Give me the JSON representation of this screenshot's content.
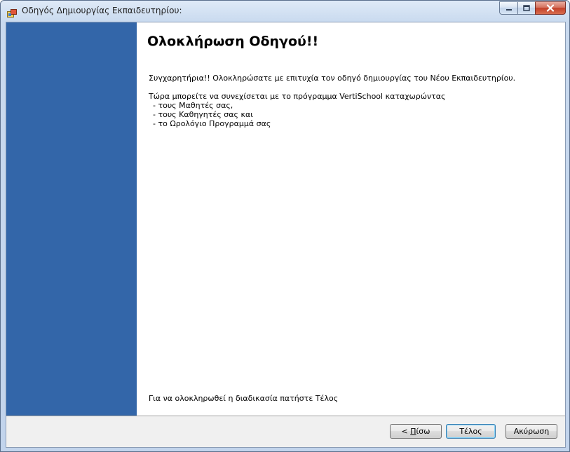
{
  "window": {
    "title": "Οδηγός Δημιουργίας Εκπαιδευτηρίου:",
    "icon": "app-window-icon"
  },
  "content": {
    "heading": "Ολοκλήρωση Οδηγού!!",
    "congrats": "Συγχαρητήρια!! Ολοκληρώσατε με επιτυχία τον οδηγό δημιουργίας του Νέου Εκπαιδευτηρίου.",
    "continue_text": "Τώρα μπορείτε να συνεχίσεται με το πρόγραμμα VertiSchool καταχωρώντας",
    "items": [
      "- τους Μαθητές σας,",
      "- τους Καθηγητές σας και",
      "- το Ωρολόγιο Προγραμμά σας"
    ],
    "footer_note": "Για να ολοκληρωθεί η διαδικασία πατήστε Τέλος"
  },
  "buttons": {
    "back_prefix": "< ",
    "back_mnemonic": "Π",
    "back_rest": "ίσω",
    "finish": "Τέλος",
    "cancel": "Ακύρωση"
  },
  "colors": {
    "side_panel": "#3366a9",
    "content_bg": "#ffffff"
  }
}
